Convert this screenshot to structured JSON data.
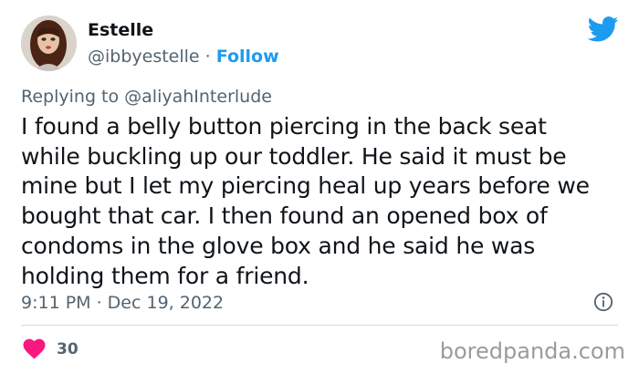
{
  "user": {
    "display_name": "Estelle",
    "handle": "@ibbyestelle",
    "separator": " · ",
    "follow_label": "Follow"
  },
  "reply": {
    "prefix": "Replying to ",
    "handle": "@aliyahInterlude"
  },
  "tweet": {
    "lines": [
      "I found a belly button piercing in the back seat",
      "while buckling up our toddler. He said it must be",
      "mine but I let my piercing heal up years before we",
      "bought that car. I then found an opened box of",
      "condoms in the glove box and he said he was",
      "holding them for a friend."
    ],
    "timestamp": "9:11 PM · Dec 19, 2022"
  },
  "engagement": {
    "like_count": "30"
  },
  "watermark": "boredpanda.com",
  "icons": {
    "brand": "twitter-bird-icon",
    "info": "info-icon",
    "like": "heart-icon"
  },
  "colors": {
    "accent": "#1d9bf0",
    "like": "#f91880",
    "secondary_text": "#536471"
  }
}
